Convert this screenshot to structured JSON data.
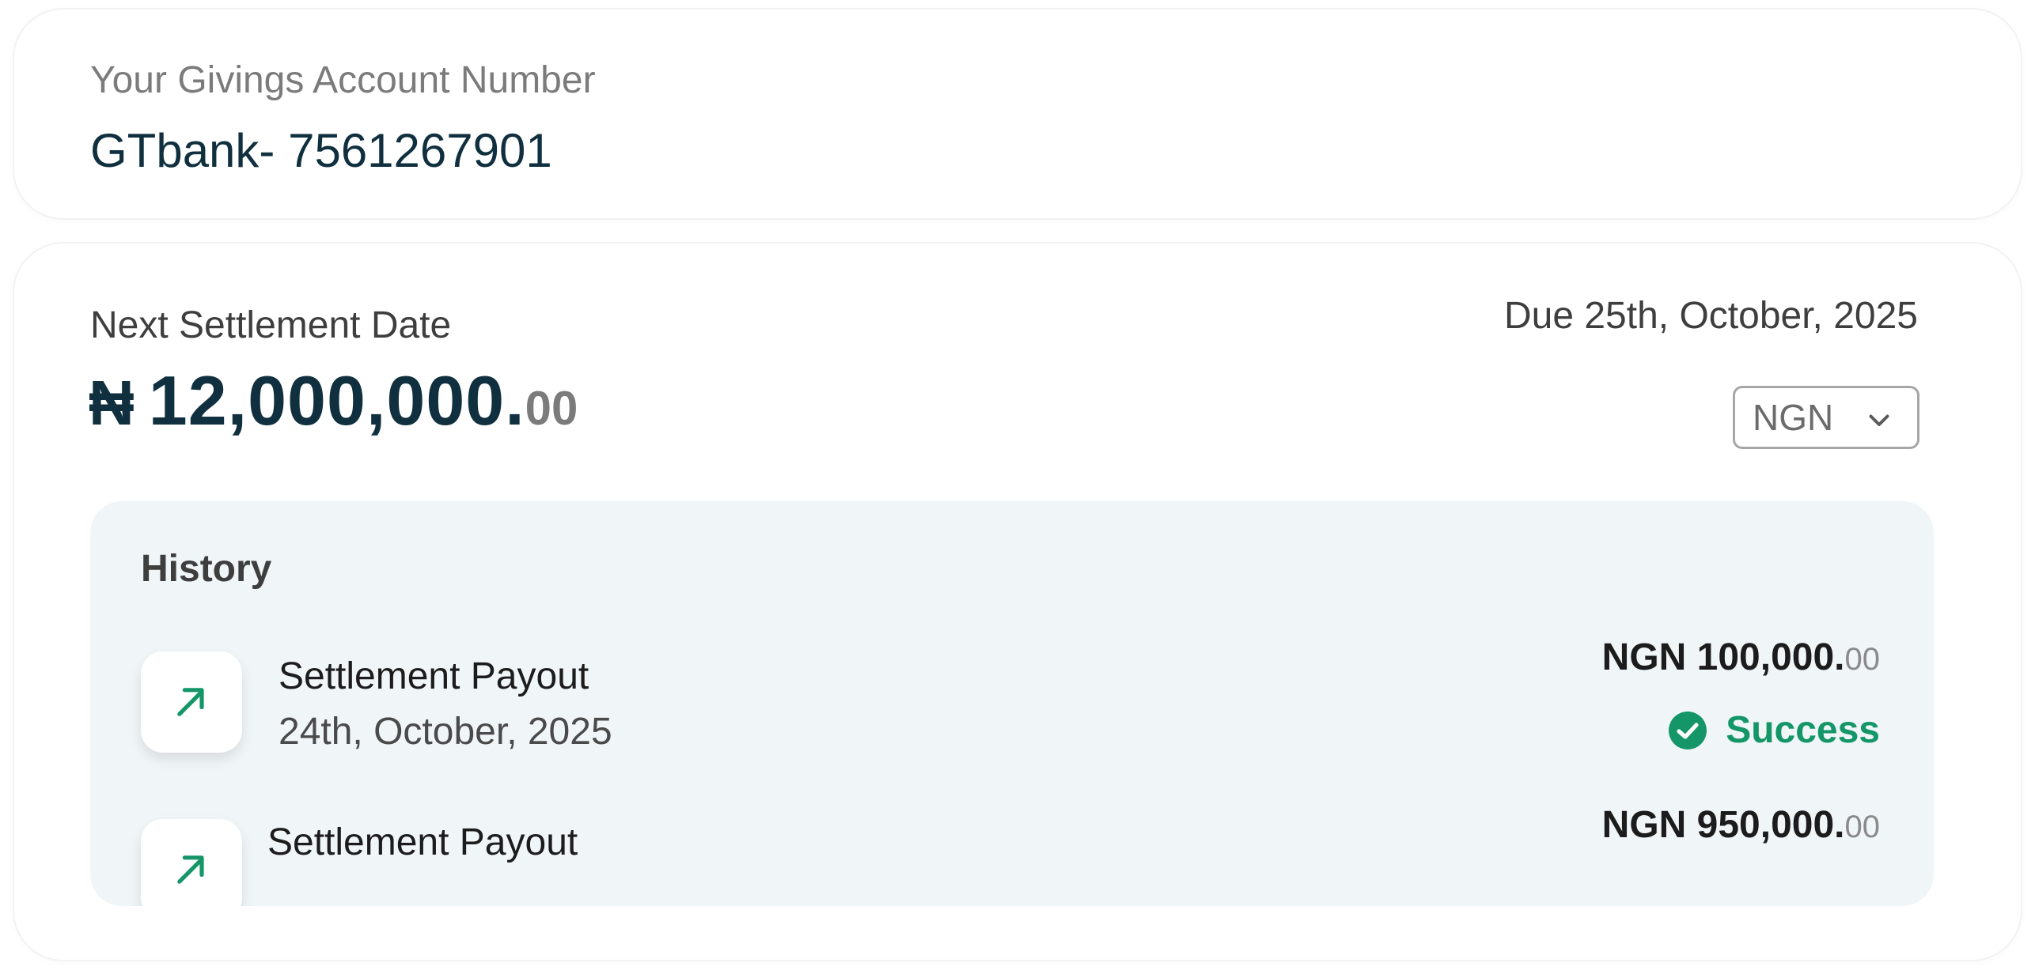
{
  "account": {
    "label": "Your Givings Account Number",
    "number": "GTbank- 7561267901"
  },
  "settlement": {
    "label": "Next Settlement Date",
    "currency_symbol": "₦",
    "amount_main": "12,000,000.",
    "amount_cents": "00",
    "due": "Due 25th, October, 2025",
    "currency_select": "NGN"
  },
  "history": {
    "title": "History",
    "items": [
      {
        "icon": "arrow-up-right-icon",
        "title": "Settlement Payout",
        "date": "24th, October, 2025",
        "amount_main": "NGN 100,000.",
        "amount_cents": "00",
        "status": "Success"
      },
      {
        "icon": "arrow-up-right-icon",
        "title": "Settlement Payout",
        "amount_main": "NGN 950,000.",
        "amount_cents": "00"
      }
    ]
  },
  "colors": {
    "primary_text": "#10303f",
    "success": "#149668",
    "history_bg": "#f0f5f8"
  }
}
